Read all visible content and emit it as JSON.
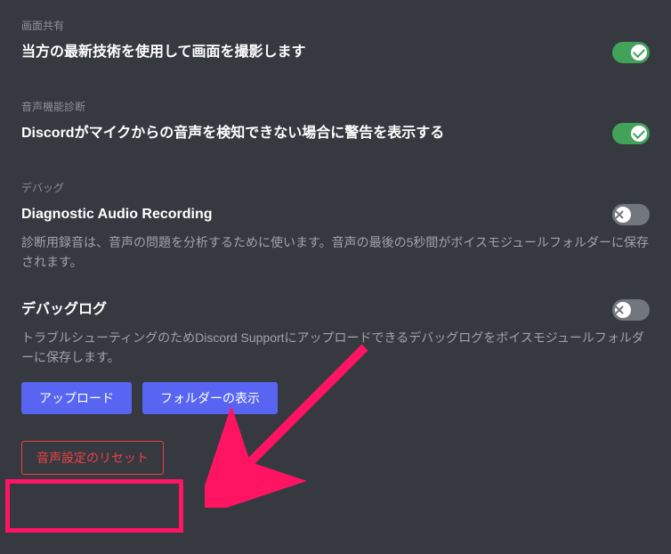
{
  "sections": {
    "screenShare": {
      "header": "画面共有",
      "title": "当方の最新技術を使用して画面を撮影します",
      "toggleOn": true
    },
    "voiceDiag": {
      "header": "音声機能診断",
      "title": "Discordがマイクからの音声を検知できない場合に警告を表示する",
      "toggleOn": true
    },
    "debug": {
      "header": "デバッグ",
      "diagnosticTitle": "Diagnostic Audio Recording",
      "diagnosticDesc": "診断用録音は、音声の問題を分析するために使います。音声の最後の5秒間がボイスモジュールフォルダーに保存されます。",
      "diagnosticToggleOn": false,
      "debugLogTitle": "デバッグログ",
      "debugLogDesc": "トラブルシューティングのためDiscord Supportにアップロードできるデバッグログをボイスモジュールフォルダーに保存します。",
      "debugLogToggleOn": false,
      "uploadBtn": "アップロード",
      "showFolderBtn": "フォルダーの表示"
    },
    "resetBtn": "音声設定のリセット"
  }
}
